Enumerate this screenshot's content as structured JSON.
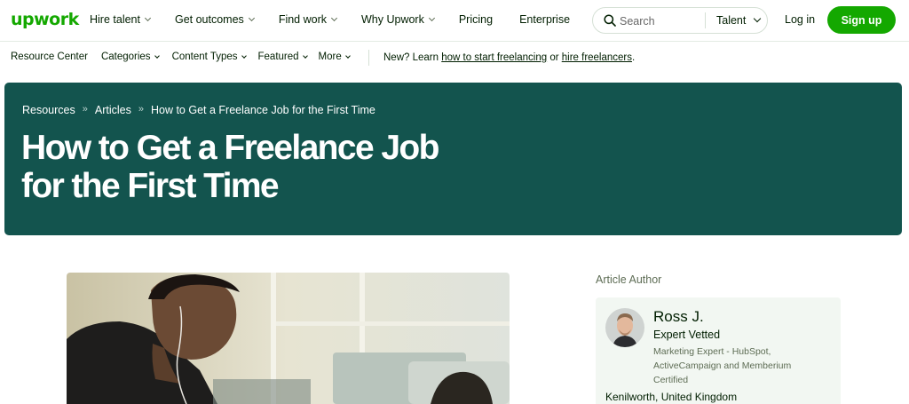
{
  "header": {
    "logo_text": "upwork",
    "nav": [
      {
        "label": "Hire talent",
        "dropdown": true
      },
      {
        "label": "Get outcomes",
        "dropdown": true
      },
      {
        "label": "Find work",
        "dropdown": true
      },
      {
        "label": "Why Upwork",
        "dropdown": true
      },
      {
        "label": "Pricing",
        "dropdown": false
      },
      {
        "label": "Enterprise",
        "dropdown": false
      }
    ],
    "search": {
      "placeholder": "Search",
      "category": "Talent"
    },
    "login_label": "Log in",
    "signup_label": "Sign up"
  },
  "subnav": {
    "items": [
      {
        "label": "Resource Center",
        "dropdown": false
      },
      {
        "label": "Categories",
        "dropdown": true
      },
      {
        "label": "Content Types",
        "dropdown": true
      },
      {
        "label": "Featured",
        "dropdown": true
      },
      {
        "label": "More",
        "dropdown": true
      }
    ],
    "promo": {
      "prefix": "New? Learn ",
      "link1": "how to start freelancing",
      "middle": " or ",
      "link2": "hire freelancers",
      "suffix": "."
    }
  },
  "hero": {
    "breadcrumb": [
      "Resources",
      "Articles",
      "How to Get a Freelance Job for the First Time"
    ],
    "breadcrumb_sep": "»",
    "title": "How to Get a Freelance Job for the First Time"
  },
  "author": {
    "heading": "Article Author",
    "name": "Ross J.",
    "badge": "Expert Vetted",
    "description": "Marketing Expert - HubSpot, ActiveCampaign and Memberium Certified",
    "location": "Kenilworth, United Kingdom"
  },
  "colors": {
    "brand_green": "#14a800",
    "hero_bg": "#13544e",
    "author_card_bg": "#f2f7f2"
  }
}
